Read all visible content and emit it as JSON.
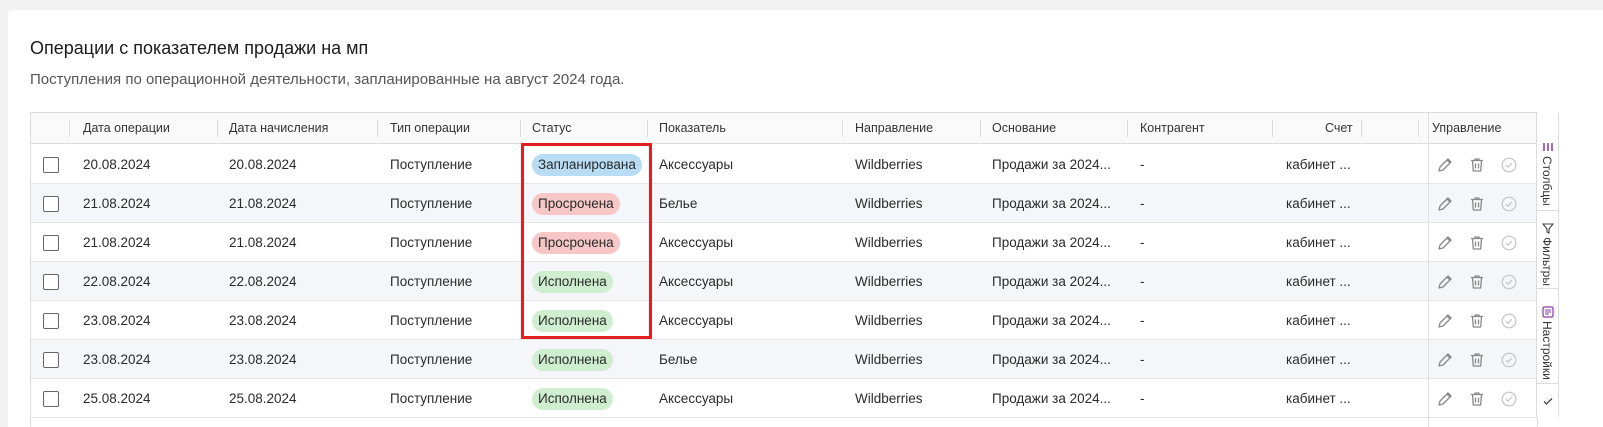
{
  "header": {
    "title": "Операции с показателем продажи на мп",
    "subtitle": "Поступления по операционной деятельности, запланированные на август 2024 года."
  },
  "table": {
    "columns": [
      "Дата операции",
      "Дата начисления",
      "Тип операции",
      "Статус",
      "Показатель",
      "Направление",
      "Основание",
      "Контрагент",
      "Счет",
      "Управление"
    ],
    "rows": [
      {
        "op_date": "20.08.2024",
        "acc_date": "20.08.2024",
        "type": "Поступление",
        "status": "Запланирована",
        "status_kind": "planned",
        "indicator": "Аксессуары",
        "direction": "Wildberries",
        "basis": "Продажи за 2024...",
        "counterparty": "-",
        "account": "кабинет ..."
      },
      {
        "op_date": "21.08.2024",
        "acc_date": "21.08.2024",
        "type": "Поступление",
        "status": "Просрочена",
        "status_kind": "overdue",
        "indicator": "Белье",
        "direction": "Wildberries",
        "basis": "Продажи за 2024...",
        "counterparty": "-",
        "account": "кабинет ..."
      },
      {
        "op_date": "21.08.2024",
        "acc_date": "21.08.2024",
        "type": "Поступление",
        "status": "Просрочена",
        "status_kind": "overdue",
        "indicator": "Аксессуары",
        "direction": "Wildberries",
        "basis": "Продажи за 2024...",
        "counterparty": "-",
        "account": "кабинет ..."
      },
      {
        "op_date": "22.08.2024",
        "acc_date": "22.08.2024",
        "type": "Поступление",
        "status": "Исполнена",
        "status_kind": "done",
        "indicator": "Аксессуары",
        "direction": "Wildberries",
        "basis": "Продажи за 2024...",
        "counterparty": "-",
        "account": "кабинет ..."
      },
      {
        "op_date": "23.08.2024",
        "acc_date": "23.08.2024",
        "type": "Поступление",
        "status": "Исполнена",
        "status_kind": "done",
        "indicator": "Аксессуары",
        "direction": "Wildberries",
        "basis": "Продажи за 2024...",
        "counterparty": "-",
        "account": "кабинет ..."
      },
      {
        "op_date": "23.08.2024",
        "acc_date": "23.08.2024",
        "type": "Поступление",
        "status": "Исполнена",
        "status_kind": "done",
        "indicator": "Белье",
        "direction": "Wildberries",
        "basis": "Продажи за 2024...",
        "counterparty": "-",
        "account": "кабинет ..."
      },
      {
        "op_date": "25.08.2024",
        "acc_date": "25.08.2024",
        "type": "Поступление",
        "status": "Исполнена",
        "status_kind": "done",
        "indicator": "Аксессуары",
        "direction": "Wildberries",
        "basis": "Продажи за 2024...",
        "counterparty": "-",
        "account": "кабинет ..."
      }
    ]
  },
  "sidebar": {
    "tabs": [
      {
        "label": "Столбцы",
        "icon": "columns-icon"
      },
      {
        "label": "Фильтры",
        "icon": "filter-icon"
      },
      {
        "label": "Настройки",
        "icon": "settings-icon"
      }
    ]
  },
  "colors": {
    "planned": "#b7dcf4",
    "overdue": "#f7c7c7",
    "done": "#cfeecf",
    "highlight": "#e02020"
  }
}
